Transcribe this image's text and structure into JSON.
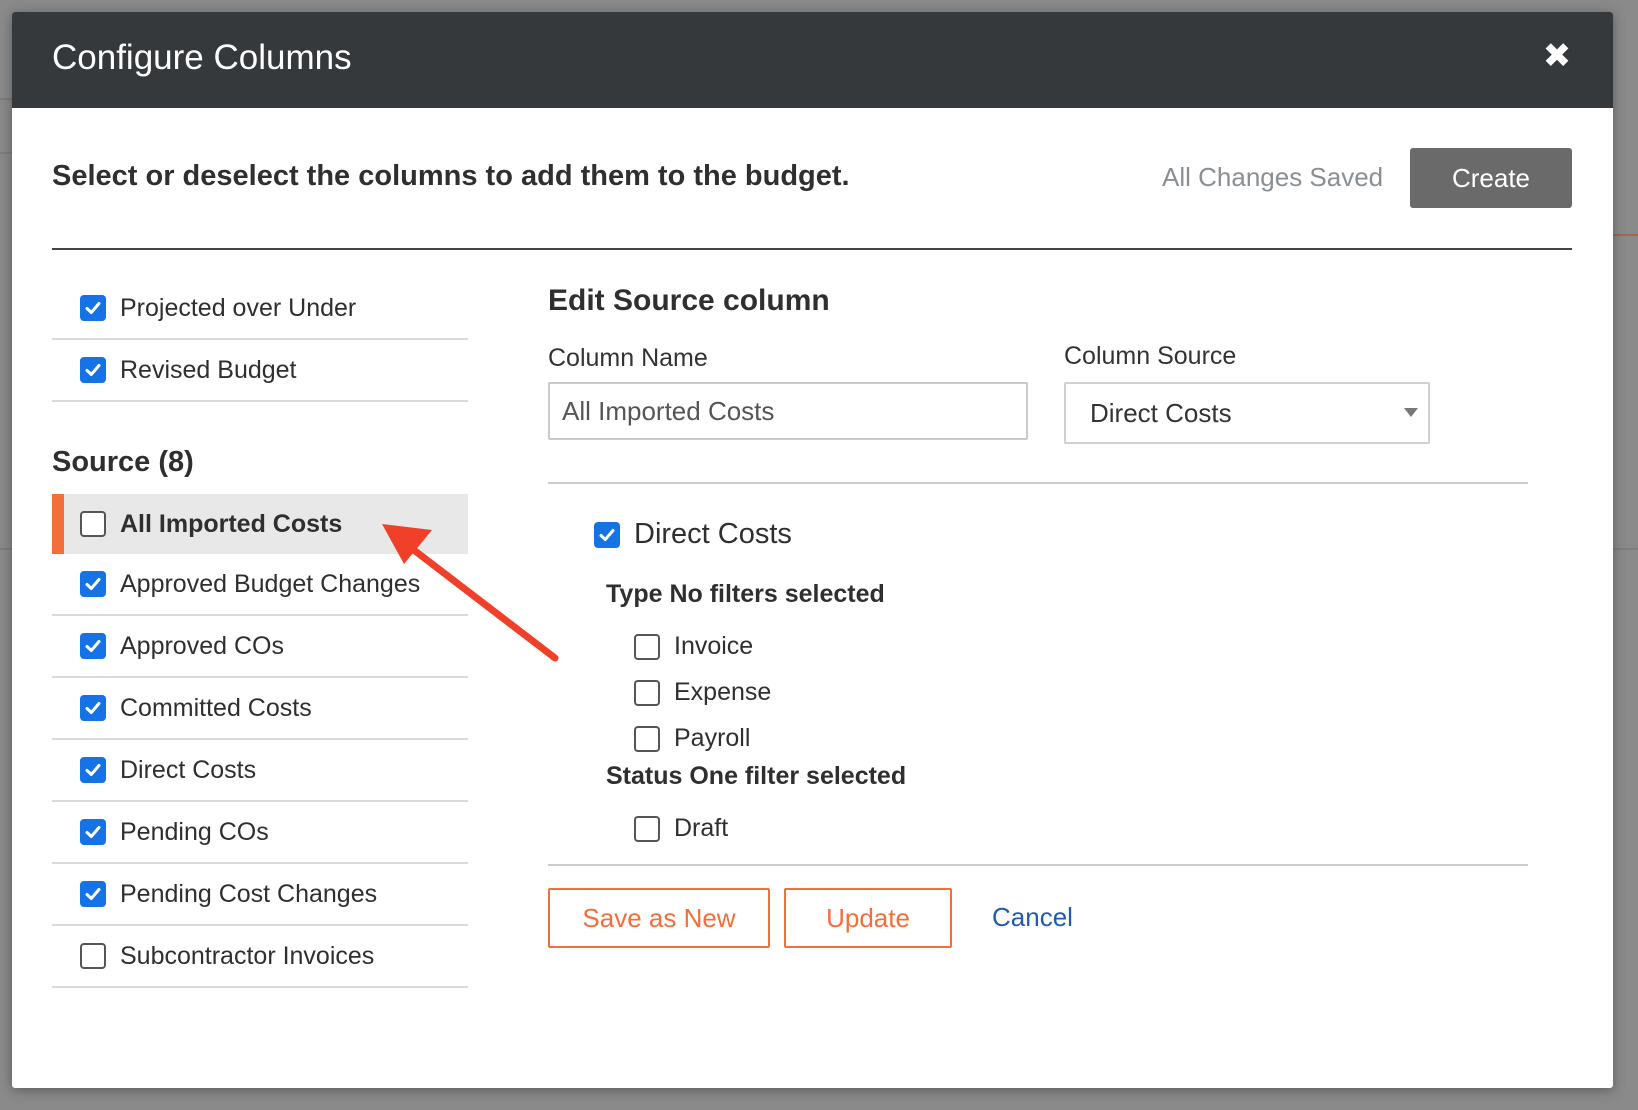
{
  "modal": {
    "title": "Configure Columns",
    "close_glyph": "✖"
  },
  "toolbar": {
    "instruction": "Select or deselect the columns to add them to the budget.",
    "saved_status": "All Changes Saved",
    "create_label": "Create"
  },
  "columns_top": [
    {
      "label": "Projected over Under",
      "checked": true
    },
    {
      "label": "Revised Budget",
      "checked": true
    }
  ],
  "source": {
    "title": "Source (8)",
    "items": [
      {
        "label": "All Imported Costs",
        "checked": false,
        "selected": true
      },
      {
        "label": "Approved Budget Changes",
        "checked": true
      },
      {
        "label": "Approved COs",
        "checked": true
      },
      {
        "label": "Committed Costs",
        "checked": true
      },
      {
        "label": "Direct Costs",
        "checked": true
      },
      {
        "label": "Pending COs",
        "checked": true
      },
      {
        "label": "Pending Cost Changes",
        "checked": true
      },
      {
        "label": "Subcontractor Invoices",
        "checked": false
      }
    ]
  },
  "editor": {
    "title": "Edit Source column",
    "column_name_label": "Column Name",
    "column_name_value": "All Imported Costs",
    "column_source_label": "Column Source",
    "column_source_value": "Direct Costs",
    "source_toggle": {
      "label": "Direct Costs",
      "checked": true
    },
    "type_heading": "Type No filters selected",
    "type_filters": [
      {
        "label": "Invoice",
        "checked": false
      },
      {
        "label": "Expense",
        "checked": false
      },
      {
        "label": "Payroll",
        "checked": false
      }
    ],
    "status_heading": "Status One filter selected",
    "status_filters": [
      {
        "label": "Draft",
        "checked": false
      }
    ],
    "save_as_new_label": "Save as New",
    "update_label": "Update",
    "cancel_label": "Cancel"
  },
  "colors": {
    "accent": "#f26f3a",
    "checkbox": "#1673e6",
    "header": "#35393c",
    "annotation": "#f0402a"
  }
}
